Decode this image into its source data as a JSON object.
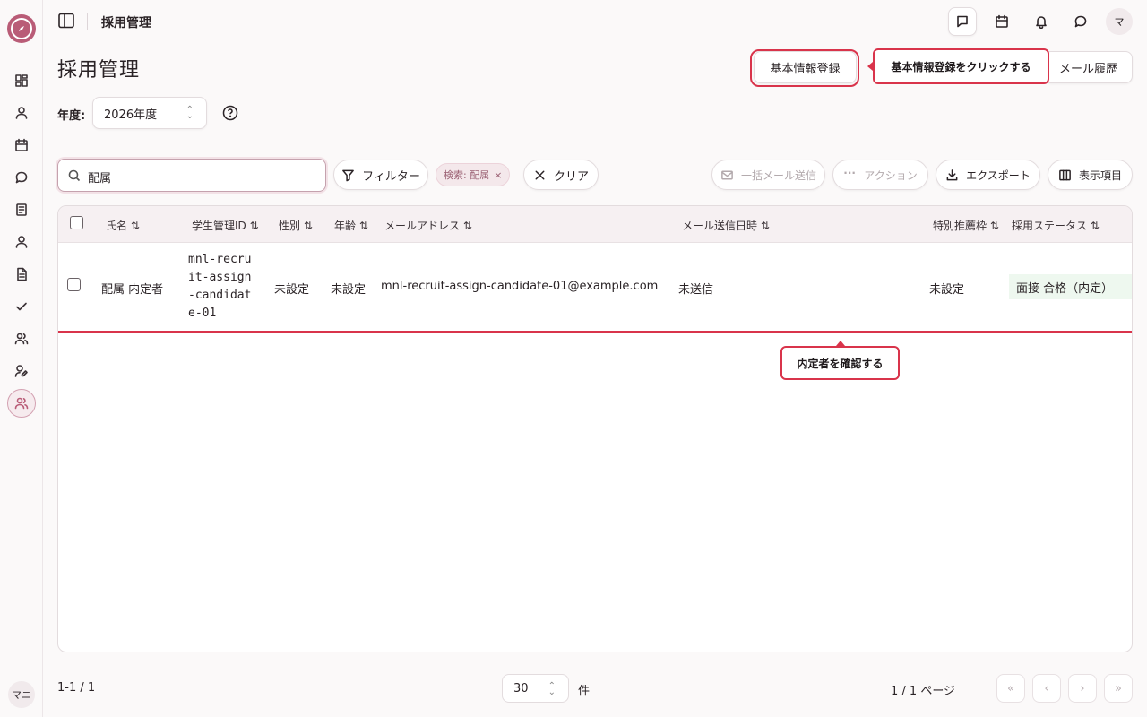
{
  "header": {
    "title": "採用管理"
  },
  "user": {
    "sidebar_avatar": "マニ",
    "header_avatar": "マ"
  },
  "page": {
    "title": "採用管理",
    "register_button": "基本情報登録",
    "mail_history_button": "メール履歴",
    "year_label": "年度:",
    "year_value": "2026年度"
  },
  "tooltips": {
    "register_hint": "基本情報登録をクリックする",
    "row_hint": "内定者を確認する"
  },
  "toolbar": {
    "search_value": "配属",
    "filter_label": "フィルター",
    "chip_label": "検索: 配属",
    "clear_label": "クリア",
    "bulk_mail_label": "一括メール送信",
    "action_label": "アクション",
    "export_label": "エクスポート",
    "columns_label": "表示項目"
  },
  "table": {
    "columns": [
      "氏名 ⇅",
      "学生管理ID ⇅",
      "性別 ⇅",
      "年齢 ⇅",
      "メールアドレス ⇅",
      "メール送信日時 ⇅",
      "特別推薦枠 ⇅",
      "採用ステータス ⇅"
    ],
    "rows": [
      {
        "name": "配属 内定者",
        "id_line1": "mnl-recru",
        "id_line2": "it-assign",
        "id_line3": "-candidat",
        "id_line4": "e-01",
        "gender": "未設定",
        "age": "未設定",
        "email": "mnl-recruit-assign-candidate-01@example.com",
        "mail_sent": "未送信",
        "special": "未設定",
        "status": "面接 合格（内定）"
      }
    ]
  },
  "footer": {
    "count": "1-1 / 1",
    "per_page": "30",
    "unit": "件",
    "page_info": "1 / 1 ページ"
  },
  "colors": {
    "accent": "#b95c77",
    "highlight": "#d9344b",
    "status_bg": "#eef8ef"
  }
}
